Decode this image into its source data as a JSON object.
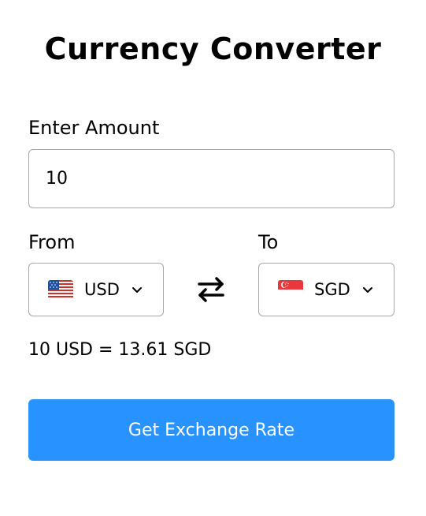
{
  "title": "Currency Converter",
  "amount": {
    "label": "Enter Amount",
    "value": "10"
  },
  "from": {
    "label": "From",
    "currency": "USD",
    "flag": "us-flag-icon"
  },
  "to": {
    "label": "To",
    "currency": "SGD",
    "flag": "sg-flag-icon"
  },
  "swap_icon": "swap-arrows-icon",
  "result": "10 USD = 13.61 SGD",
  "button": {
    "label": "Get Exchange Rate",
    "color": "#2893ff"
  }
}
